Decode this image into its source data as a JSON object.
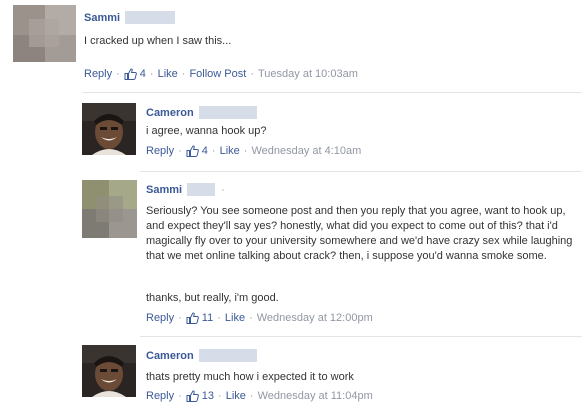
{
  "comments": [
    {
      "author": "Sammi",
      "text": "I cracked up when I saw this...",
      "actions": {
        "reply": "Reply",
        "likes": "4",
        "like": "Like",
        "follow": "Follow Post",
        "timestamp": "Tuesday at 10:03am"
      }
    },
    {
      "author": "Cameron",
      "text": "i agree, wanna hook up?",
      "actions": {
        "reply": "Reply",
        "likes": "4",
        "like": "Like",
        "timestamp": "Wednesday at 4:10am"
      }
    },
    {
      "author": "Sammi",
      "trail": "·",
      "paragraph1": "Seriously? You see someone post and then you reply that you agree, want to hook up, and expect they'll say yes? honestly, what did you expect to come out of this? that i'd magically fly over to your university somewhere and we'd have crazy sex while laughing that we met online talking about crack? then, i suppose you'd wanna smoke some.",
      "paragraph2": "thanks, but really, i'm good.",
      "actions": {
        "reply": "Reply",
        "likes": "11",
        "like": "Like",
        "timestamp": "Wednesday at 12:00pm"
      }
    },
    {
      "author": "Cameron",
      "text": "thats pretty much how i expected it to work",
      "actions": {
        "reply": "Reply",
        "likes": "13",
        "like": "Like",
        "timestamp": "Wednesday at 11:04pm"
      }
    }
  ],
  "separator": "·",
  "icons": {
    "like": "thumbs-up-icon",
    "avatar_sammi": "blurred-avatar",
    "avatar_cameron": "profile-photo"
  },
  "colors": {
    "link": "#3b5998",
    "meta": "#9197a3",
    "text": "#333333",
    "blur": "#d6dce8"
  }
}
